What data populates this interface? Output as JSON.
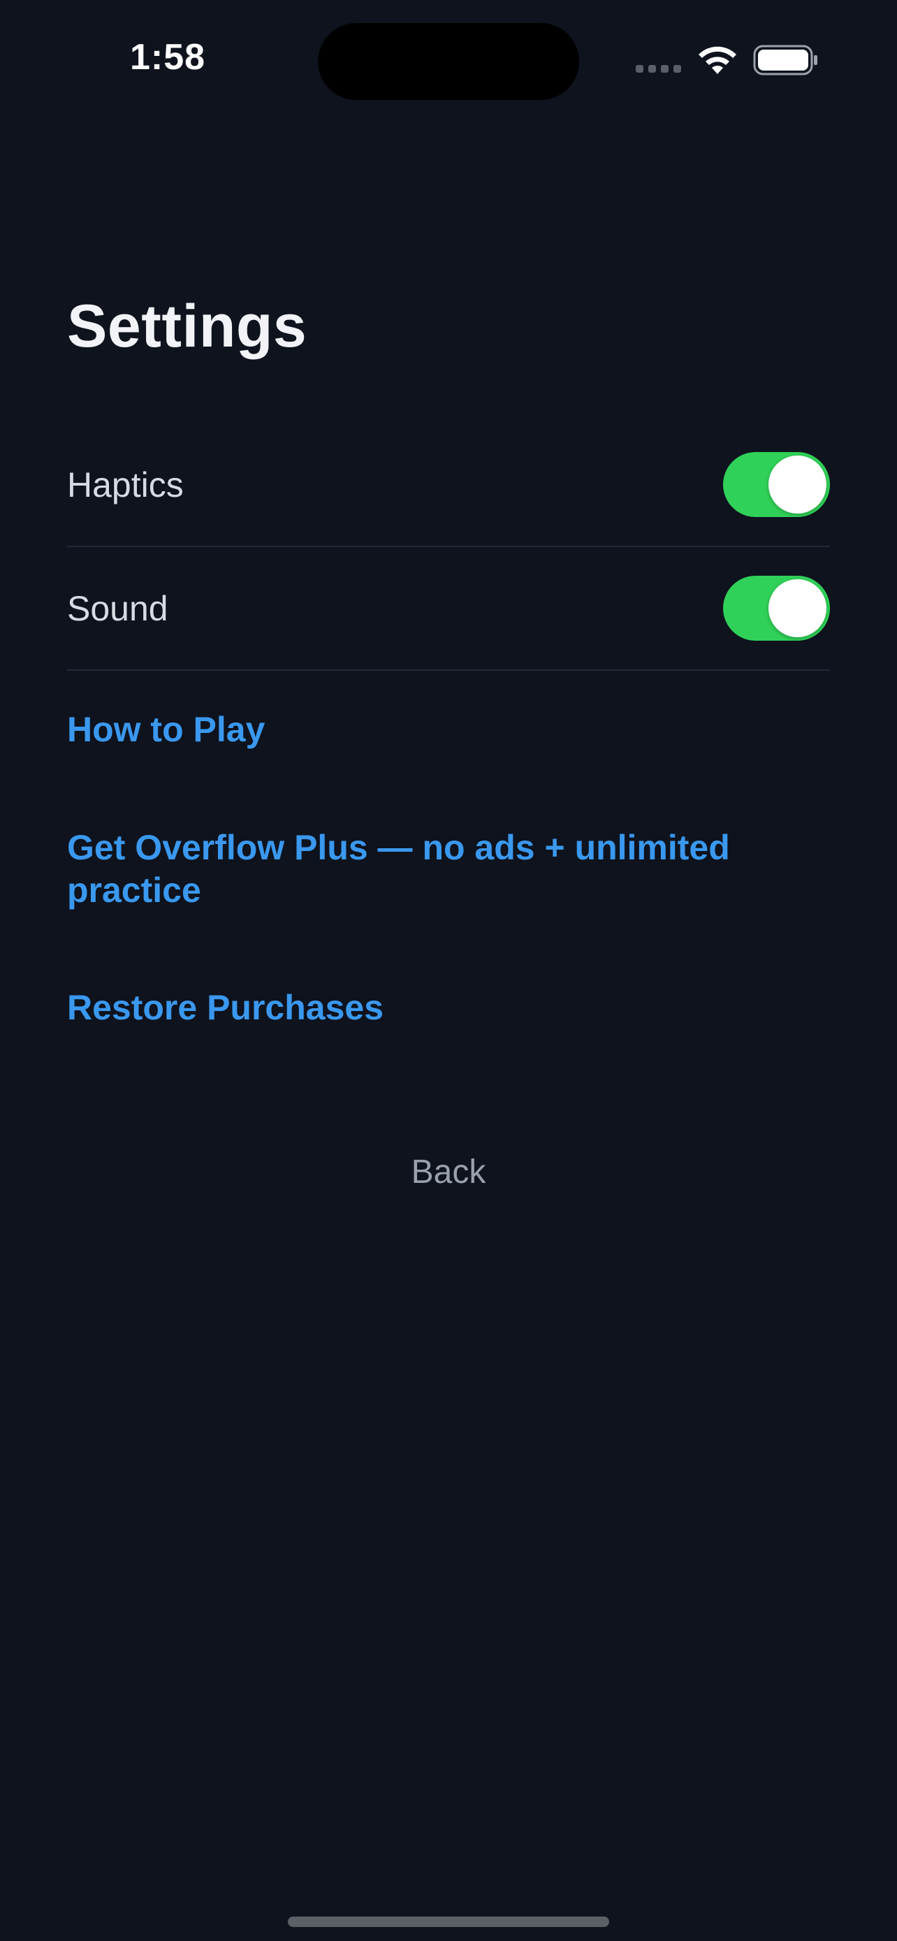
{
  "status_bar": {
    "time": "1:58"
  },
  "title": "Settings",
  "toggles": [
    {
      "label": "Haptics",
      "on": true
    },
    {
      "label": "Sound",
      "on": true
    }
  ],
  "links": {
    "how_to_play": "How to Play",
    "get_plus": "Get Overflow Plus — no ads + unlimited practice",
    "restore": "Restore Purchases"
  },
  "back_label": "Back",
  "colors": {
    "background": "#0e131e",
    "accent_link": "#3a98ee",
    "toggle_on": "#30d158"
  }
}
